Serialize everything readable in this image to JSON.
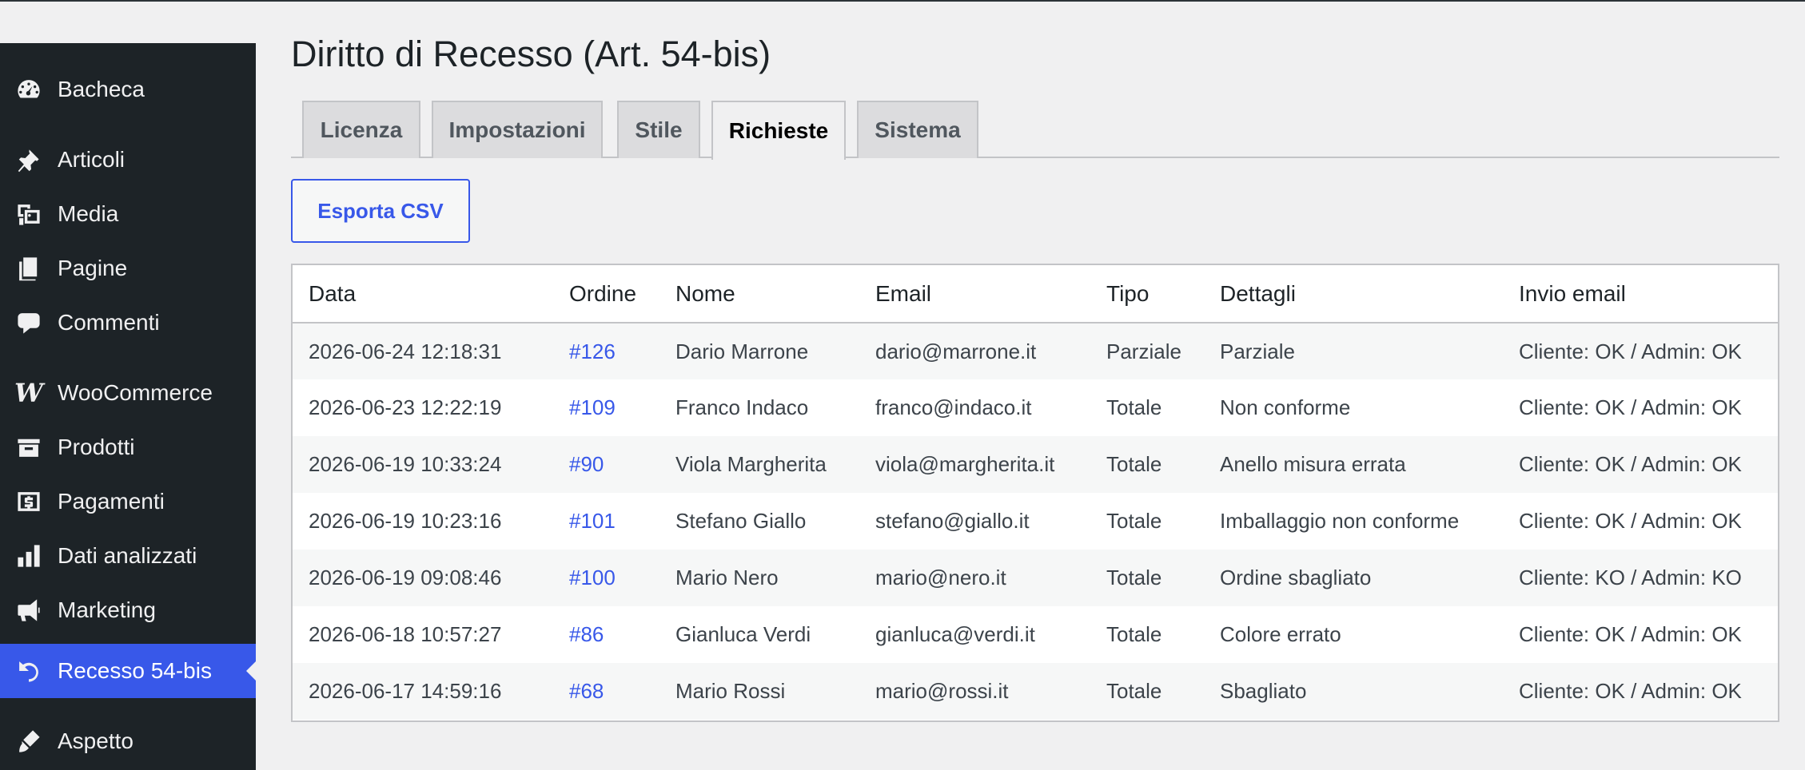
{
  "sidebar": {
    "items": [
      {
        "label": "Bacheca",
        "icon": "dashboard-icon"
      },
      {
        "label": "Articoli",
        "icon": "pushpin-icon"
      },
      {
        "label": "Media",
        "icon": "media-icon"
      },
      {
        "label": "Pagine",
        "icon": "pages-icon"
      },
      {
        "label": "Commenti",
        "icon": "comment-icon"
      },
      {
        "label": "WooCommerce",
        "icon": "woocommerce-icon"
      },
      {
        "label": "Prodotti",
        "icon": "archive-icon"
      },
      {
        "label": "Pagamenti",
        "icon": "dollar-icon"
      },
      {
        "label": "Dati analizzati",
        "icon": "bar-chart-icon"
      },
      {
        "label": "Marketing",
        "icon": "megaphone-icon"
      },
      {
        "label": "Recesso 54-bis",
        "icon": "undo-icon",
        "active": true
      },
      {
        "label": "Aspetto",
        "icon": "brush-icon"
      }
    ]
  },
  "page": {
    "title": "Diritto di Recesso (Art. 54-bis)"
  },
  "tabs": [
    {
      "label": "Licenza"
    },
    {
      "label": "Impostazioni"
    },
    {
      "label": "Stile"
    },
    {
      "label": "Richieste",
      "active": true
    },
    {
      "label": "Sistema"
    }
  ],
  "toolbar": {
    "export_label": "Esporta CSV"
  },
  "table": {
    "headers": [
      "Data",
      "Ordine",
      "Nome",
      "Email",
      "Tipo",
      "Dettagli",
      "Invio email"
    ],
    "rows": [
      [
        "2026-06-24 12:18:31",
        "#126",
        "Dario Marrone",
        "dario@marrone.it",
        "Parziale",
        "Parziale",
        "Cliente: OK / Admin: OK"
      ],
      [
        "2026-06-23 12:22:19",
        "#109",
        "Franco Indaco",
        "franco@indaco.it",
        "Totale",
        "Non conforme",
        "Cliente: OK / Admin: OK"
      ],
      [
        "2026-06-19 10:33:24",
        "#90",
        "Viola Margherita",
        "viola@margherita.it",
        "Totale",
        "Anello misura errata",
        "Cliente: OK / Admin: OK"
      ],
      [
        "2026-06-19 10:23:16",
        "#101",
        "Stefano Giallo",
        "stefano@giallo.it",
        "Totale",
        "Imballaggio non conforme",
        "Cliente: OK / Admin: OK"
      ],
      [
        "2026-06-19 09:08:46",
        "#100",
        "Mario Nero",
        "mario@nero.it",
        "Totale",
        "Ordine sbagliato",
        "Cliente: KO / Admin: KO"
      ],
      [
        "2026-06-18 10:57:27",
        "#86",
        "Gianluca Verdi",
        "gianluca@verdi.it",
        "Totale",
        "Colore errato",
        "Cliente: OK / Admin: OK"
      ],
      [
        "2026-06-17 14:59:16",
        "#68",
        "Mario Rossi",
        "mario@rossi.it",
        "Totale",
        "Sbagliato",
        "Cliente: OK / Admin: OK"
      ]
    ]
  },
  "colors": {
    "sidebar_bg": "#1d2327",
    "accent": "#3858e9",
    "page_bg": "#f0f0f1"
  }
}
